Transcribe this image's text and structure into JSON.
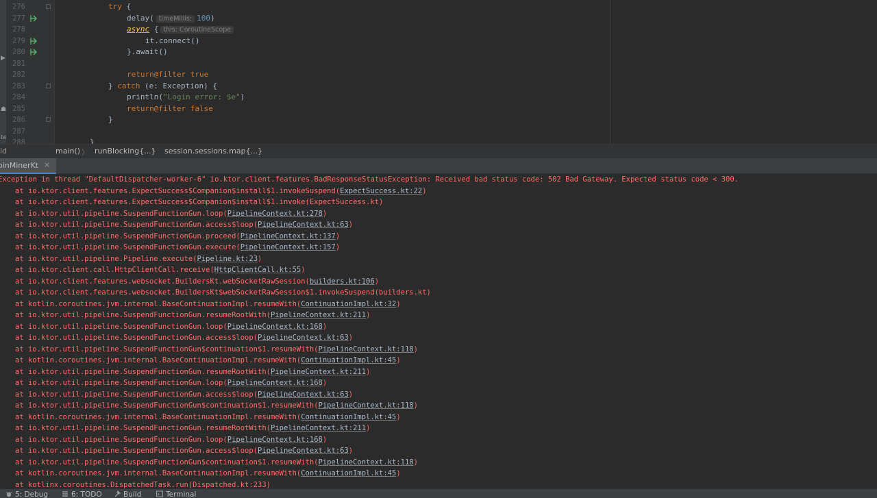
{
  "editor": {
    "lines": [
      {
        "n": "276",
        "hint": ""
      },
      {
        "n": "277",
        "hint": ""
      },
      {
        "n": "278",
        "hint": ""
      },
      {
        "n": "279",
        "hint": ""
      },
      {
        "n": "280",
        "hint": ""
      },
      {
        "n": "281",
        "hint": ""
      },
      {
        "n": "282",
        "hint": ""
      },
      {
        "n": "283",
        "hint": ""
      },
      {
        "n": "284",
        "hint": ""
      },
      {
        "n": "285",
        "hint": ""
      },
      {
        "n": "286",
        "hint": ""
      },
      {
        "n": "287",
        "hint": ""
      },
      {
        "n": "288",
        "hint": ""
      }
    ],
    "code": {
      "l276_kw": "try",
      "l276_rest": " {",
      "l277_fn": "delay(",
      "l277_hint": "timeMillis:",
      "l277_num": "100",
      "l277_close": ")",
      "l278_fn": "async",
      "l278_brace": " {",
      "l278_hint": "this: CoroutineScope",
      "l279": "it.connect()",
      "l280": "}.await()",
      "l282_kw": "return",
      "l282_lbl": "@filter",
      "l282_val": " true",
      "l283_brace": "} ",
      "l283_kw": "catch",
      "l283_rest": " (e: Exception) {",
      "l284_fn": "println(",
      "l284_str": "\"Login error: $e\"",
      "l284_close": ")",
      "l285_kw": "return",
      "l285_lbl": "@filter",
      "l285_val": " false",
      "l286": "}",
      "l288": "}"
    },
    "left_markers": [
      "▶",
      "☗",
      "te",
      "ld"
    ],
    "colors": {
      "keyword": "#cc7832",
      "number": "#6897bb",
      "string": "#6a8759",
      "function": "#ffc66d",
      "text": "#a9b7c6"
    }
  },
  "breadcrumb": {
    "items": [
      "main()",
      "runBlocking{...}",
      "session.sessions.map{...}"
    ],
    "separator": "〉"
  },
  "run_panel": {
    "tab_label": "oinMinerKt",
    "tab_close": "×"
  },
  "console": {
    "error_color": "#ff6b68",
    "main_line": "Exception in thread \"DefaultDispatcher-worker-6\" io.ktor.client.features.BadResponseStatusException: Received bad status code: 502 Bad Gateway. Expected status code < 300.",
    "frames": [
      {
        "t": "at io.ktor.client.features.ExpectSuccess$Companion$install$1.invokeSuspend(",
        "l": "ExpectSuccess.kt:22",
        "e": ")"
      },
      {
        "t": "at io.ktor.client.features.ExpectSuccess$Companion$install$1.invoke(ExpectSuccess.kt)",
        "l": "",
        "e": ""
      },
      {
        "t": "at io.ktor.util.pipeline.SuspendFunctionGun.loop(",
        "l": "PipelineContext.kt:278",
        "e": ")"
      },
      {
        "t": "at io.ktor.util.pipeline.SuspendFunctionGun.access$loop(",
        "l": "PipelineContext.kt:63",
        "e": ")"
      },
      {
        "t": "at io.ktor.util.pipeline.SuspendFunctionGun.proceed(",
        "l": "PipelineContext.kt:137",
        "e": ")"
      },
      {
        "t": "at io.ktor.util.pipeline.SuspendFunctionGun.execute(",
        "l": "PipelineContext.kt:157",
        "e": ")"
      },
      {
        "t": "at io.ktor.util.pipeline.Pipeline.execute(",
        "l": "Pipeline.kt:23",
        "e": ")"
      },
      {
        "t": "at io.ktor.client.call.HttpClientCall.receive(",
        "l": "HttpClientCall.kt:55",
        "e": ")"
      },
      {
        "t": "at io.ktor.client.features.websocket.BuildersKt.webSocketRawSession(",
        "l": "builders.kt:106",
        "e": ")"
      },
      {
        "t": "at io.ktor.client.features.websocket.BuildersKt$webSocketRawSession$1.invokeSuspend(builders.kt)",
        "l": "",
        "e": ""
      },
      {
        "t": "at kotlin.coroutines.jvm.internal.BaseContinuationImpl.resumeWith(",
        "l": "ContinuationImpl.kt:32",
        "e": ")"
      },
      {
        "t": "at io.ktor.util.pipeline.SuspendFunctionGun.resumeRootWith(",
        "l": "PipelineContext.kt:211",
        "e": ")"
      },
      {
        "t": "at io.ktor.util.pipeline.SuspendFunctionGun.loop(",
        "l": "PipelineContext.kt:168",
        "e": ")"
      },
      {
        "t": "at io.ktor.util.pipeline.SuspendFunctionGun.access$loop(",
        "l": "PipelineContext.kt:63",
        "e": ")"
      },
      {
        "t": "at io.ktor.util.pipeline.SuspendFunctionGun$continuation$1.resumeWith(",
        "l": "PipelineContext.kt:118",
        "e": ")"
      },
      {
        "t": "at kotlin.coroutines.jvm.internal.BaseContinuationImpl.resumeWith(",
        "l": "ContinuationImpl.kt:45",
        "e": ")"
      },
      {
        "t": "at io.ktor.util.pipeline.SuspendFunctionGun.resumeRootWith(",
        "l": "PipelineContext.kt:211",
        "e": ")"
      },
      {
        "t": "at io.ktor.util.pipeline.SuspendFunctionGun.loop(",
        "l": "PipelineContext.kt:168",
        "e": ")"
      },
      {
        "t": "at io.ktor.util.pipeline.SuspendFunctionGun.access$loop(",
        "l": "PipelineContext.kt:63",
        "e": ")"
      },
      {
        "t": "at io.ktor.util.pipeline.SuspendFunctionGun$continuation$1.resumeWith(",
        "l": "PipelineContext.kt:118",
        "e": ")"
      },
      {
        "t": "at kotlin.coroutines.jvm.internal.BaseContinuationImpl.resumeWith(",
        "l": "ContinuationImpl.kt:45",
        "e": ")"
      },
      {
        "t": "at io.ktor.util.pipeline.SuspendFunctionGun.resumeRootWith(",
        "l": "PipelineContext.kt:211",
        "e": ")"
      },
      {
        "t": "at io.ktor.util.pipeline.SuspendFunctionGun.loop(",
        "l": "PipelineContext.kt:168",
        "e": ")"
      },
      {
        "t": "at io.ktor.util.pipeline.SuspendFunctionGun.access$loop(",
        "l": "PipelineContext.kt:63",
        "e": ")"
      },
      {
        "t": "at io.ktor.util.pipeline.SuspendFunctionGun$continuation$1.resumeWith(",
        "l": "PipelineContext.kt:118",
        "e": ")"
      },
      {
        "t": "at kotlin.coroutines.jvm.internal.BaseContinuationImpl.resumeWith(",
        "l": "ContinuationImpl.kt:45",
        "e": ")"
      },
      {
        "t": "at kotlinx.coroutines.DispatchedTask.run(Dispatched.kt:233)",
        "l": "",
        "e": ""
      }
    ]
  },
  "statusbar": {
    "tools": [
      {
        "label": "5: Debug",
        "icon": "debug-icon"
      },
      {
        "label": "6: TODO",
        "icon": "todo-icon"
      },
      {
        "label": "Build",
        "icon": "build-icon"
      },
      {
        "label": "Terminal",
        "icon": "terminal-icon"
      }
    ]
  }
}
